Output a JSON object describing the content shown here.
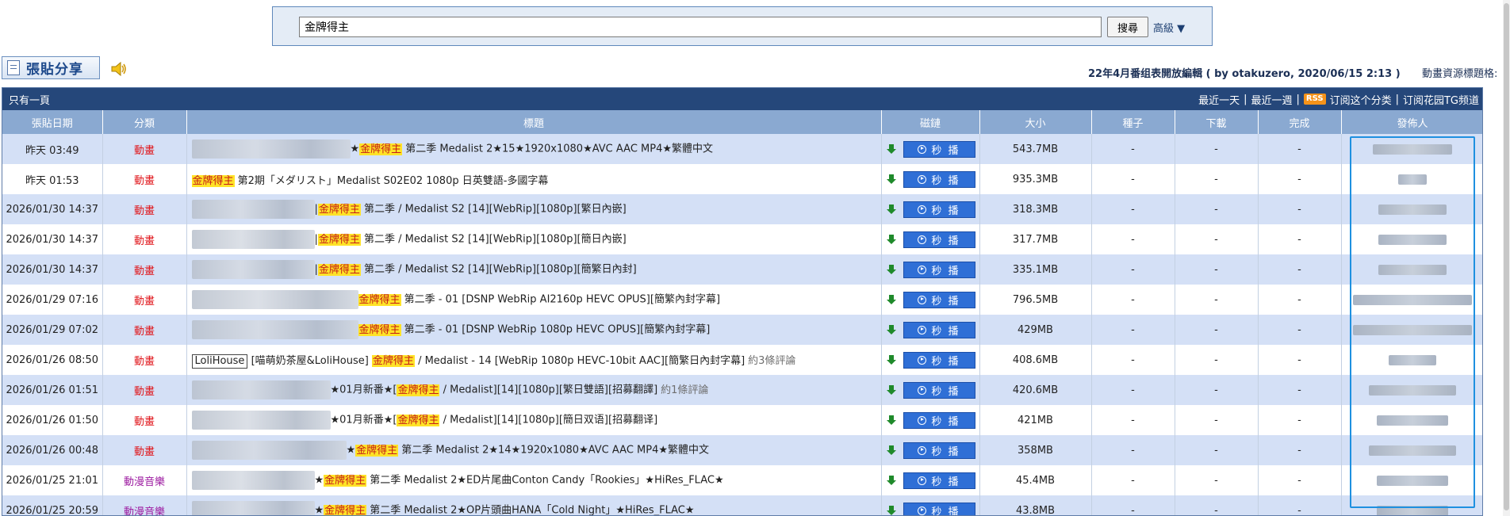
{
  "search": {
    "value": "金牌得主",
    "button_label": "搜尋",
    "advanced_label": "高級 ▼"
  },
  "header": {
    "post_button_label": "張貼分享",
    "notice": "22年4月番组表開放編輯 ( by otakuzero, 2020/06/15 2:13 )",
    "notice_tail": "動畫資源標題格:"
  },
  "topbar": {
    "left": "只有一頁",
    "links": [
      "最近一天",
      "最近一週"
    ],
    "rss_badge": "RSS",
    "subscribe_category": "订阅这个分类",
    "subscribe_tg": "订阅花园TG频道"
  },
  "columns": [
    "張貼日期",
    "分類",
    "標題",
    "磁鏈",
    "大小",
    "種子",
    "下載",
    "完成",
    "發佈人"
  ],
  "magnet_button_label": "秒 播",
  "highlight_term": "金牌得主",
  "colors": {
    "anime": "#e0161b",
    "music": "#9c1aa0",
    "highlight": "#ffe327",
    "header": "#25477a",
    "play": "#2f6fd6"
  },
  "rows": [
    {
      "date": "昨天 03:49",
      "category": "動畫",
      "cat_type": "anime",
      "title_before": "★",
      "title_after": " 第二季 Medalist 2★15★1920x1080★AVC AAC MP4★繁體中文",
      "team": "",
      "comment": "",
      "size": "543.7MB",
      "seeds": "-",
      "downloads": "-",
      "completed": "-"
    },
    {
      "date": "昨天 01:53",
      "category": "動畫",
      "cat_type": "anime",
      "title_before": "",
      "title_after": " 第2期「メダリスト」Medalist S02E02 1080p 日英雙語-多國字幕",
      "team": "",
      "comment": "",
      "size": "935.3MB",
      "seeds": "-",
      "downloads": "-",
      "completed": "-"
    },
    {
      "date": "2026/01/30 14:37",
      "category": "動畫",
      "cat_type": "anime",
      "title_before": "|",
      "title_after": " 第二季 / Medalist S2 [14][WebRip][1080p][繁日內嵌]",
      "team": "",
      "comment": "",
      "size": "318.3MB",
      "seeds": "-",
      "downloads": "-",
      "completed": "-"
    },
    {
      "date": "2026/01/30 14:37",
      "category": "動畫",
      "cat_type": "anime",
      "title_before": "|",
      "title_after": " 第二季 / Medalist S2 [14][WebRip][1080p][簡日內嵌]",
      "team": "",
      "comment": "",
      "size": "317.7MB",
      "seeds": "-",
      "downloads": "-",
      "completed": "-"
    },
    {
      "date": "2026/01/30 14:37",
      "category": "動畫",
      "cat_type": "anime",
      "title_before": "|",
      "title_after": " 第二季 / Medalist S2 [14][WebRip][1080p][簡繁日內封]",
      "team": "",
      "comment": "",
      "size": "335.1MB",
      "seeds": "-",
      "downloads": "-",
      "completed": "-"
    },
    {
      "date": "2026/01/29 07:16",
      "category": "動畫",
      "cat_type": "anime",
      "title_before": "",
      "title_after": " 第二季 - 01 [DSNP WebRip AI2160p HEVC OPUS][簡繁內封字幕]",
      "team": "",
      "comment": "",
      "size": "796.5MB",
      "seeds": "-",
      "downloads": "-",
      "completed": "-"
    },
    {
      "date": "2026/01/29 07:02",
      "category": "動畫",
      "cat_type": "anime",
      "title_before": "",
      "title_after": " 第二季 - 01 [DSNP WebRip 1080p HEVC OPUS][簡繁內封字幕]",
      "team": "",
      "comment": "",
      "size": "429MB",
      "seeds": "-",
      "downloads": "-",
      "completed": "-"
    },
    {
      "date": "2026/01/26 08:50",
      "category": "動畫",
      "cat_type": "anime",
      "title_before": " [喵萌奶茶屋&LoliHouse] ",
      "title_after": " / Medalist - 14 [WebRip 1080p HEVC-10bit AAC][簡繁日內封字幕]",
      "team": "LoliHouse",
      "comment": "約3條評論",
      "size": "408.6MB",
      "seeds": "-",
      "downloads": "-",
      "completed": "-"
    },
    {
      "date": "2026/01/26 01:51",
      "category": "動畫",
      "cat_type": "anime",
      "title_before": "★01月新番★[",
      "title_after": " / Medalist][14][1080p][繁日雙語][招募翻譯]",
      "team": "",
      "comment": "約1條評論",
      "size": "420.6MB",
      "seeds": "-",
      "downloads": "-",
      "completed": "-"
    },
    {
      "date": "2026/01/26 01:50",
      "category": "動畫",
      "cat_type": "anime",
      "title_before": "★01月新番★[",
      "title_after": " / Medalist][14][1080p][簡日双语][招募翻译]",
      "team": "",
      "comment": "",
      "size": "421MB",
      "seeds": "-",
      "downloads": "-",
      "completed": "-"
    },
    {
      "date": "2026/01/26 00:48",
      "category": "動畫",
      "cat_type": "anime",
      "title_before": "★",
      "title_after": " 第二季 Medalist 2★14★1920x1080★AVC AAC MP4★繁體中文",
      "team": "",
      "comment": "",
      "size": "358MB",
      "seeds": "-",
      "downloads": "-",
      "completed": "-"
    },
    {
      "date": "2026/01/25 21:01",
      "category": "動漫音樂",
      "cat_type": "music",
      "title_before": "★",
      "title_after": " 第二季 Medalist 2★ED片尾曲Conton Candy「Rookies」★HiRes_FLAC★",
      "team": "",
      "comment": "",
      "size": "45.4MB",
      "seeds": "-",
      "downloads": "-",
      "completed": "-"
    },
    {
      "date": "2026/01/25 20:59",
      "category": "動漫音樂",
      "cat_type": "music",
      "title_before": "★",
      "title_after": " 第二季 Medalist 2★OP片頭曲HANA「Cold Night」★HiRes_FLAC★",
      "team": "",
      "comment": "",
      "size": "43.8MB",
      "seeds": "-",
      "downloads": "-",
      "completed": "-"
    }
  ]
}
